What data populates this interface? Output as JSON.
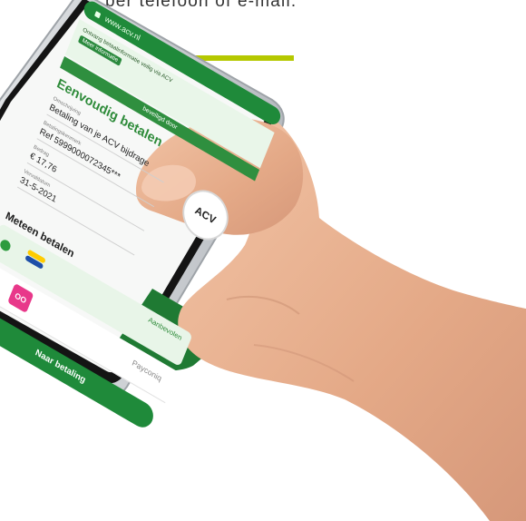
{
  "caption": "per telefoon of e-mail.",
  "phone": {
    "url_text": "www.acv.nl",
    "notice_text": "Ontvang betaalinformatie veilig via ACV",
    "notice_tag": "Meer informatie",
    "brand_text": "beveiligd door",
    "screen_title": "Eenvoudig betalen",
    "fields": [
      {
        "label": "Omschrijving",
        "value": "Betaling van je ACV bijdrage"
      },
      {
        "label": "Betalingskenmerk",
        "value": "Ref 5999000072345***"
      },
      {
        "label": "Bedrag",
        "value": "€ 17,76"
      },
      {
        "label": "Vervaldatum",
        "value": "31-5-2021"
      }
    ],
    "badge_text": "ACV",
    "section_title": "Meteen betalen",
    "recommended_label": "Aanbevolen",
    "payment_method_label": "Payconiq",
    "payment_logo_text": "OO",
    "pay_button_label": "Naar betaling"
  },
  "colors": {
    "accent_line": "#b5c800",
    "app_green": "#1f8a3a",
    "phone_frame": "#d5d8dc",
    "skin": "#e8b190"
  }
}
